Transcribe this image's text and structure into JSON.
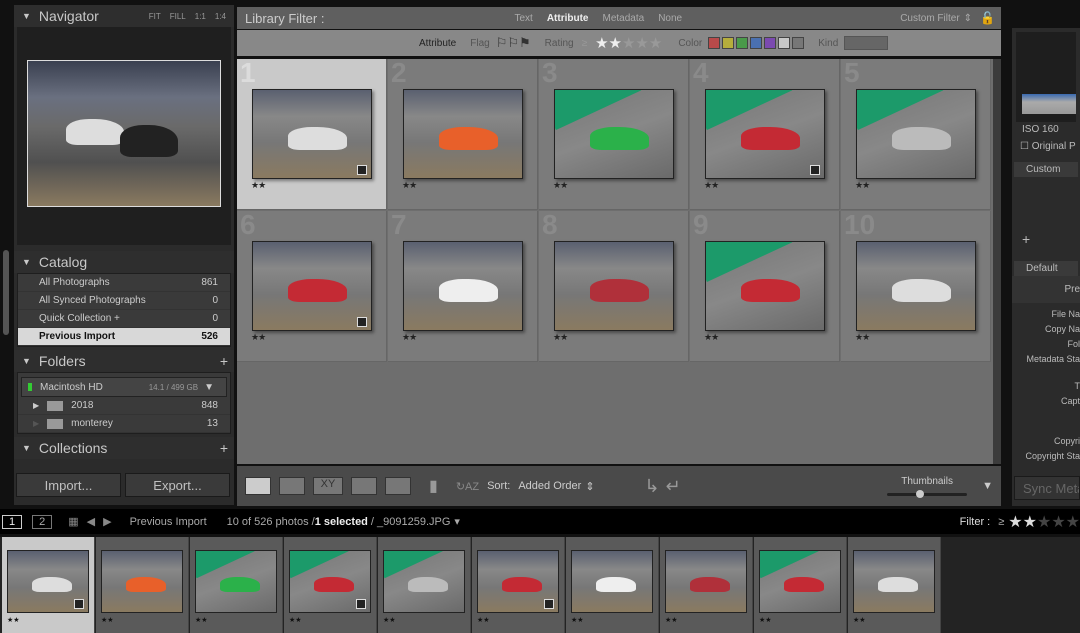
{
  "navigator": {
    "title": "Navigator",
    "options": [
      "FIT",
      "FILL",
      "1:1",
      "1:4"
    ]
  },
  "catalog": {
    "title": "Catalog",
    "items": [
      {
        "label": "All Photographs",
        "count": "861"
      },
      {
        "label": "All Synced Photographs",
        "count": "0"
      },
      {
        "label": "Quick Collection +",
        "count": "0"
      },
      {
        "label": "Previous Import",
        "count": "526",
        "selected": true
      }
    ]
  },
  "folders": {
    "title": "Folders",
    "volume": {
      "name": "Macintosh HD",
      "usage": "14.1 / 499 GB"
    },
    "items": [
      {
        "label": "2018",
        "count": "848"
      },
      {
        "label": "monterey",
        "count": "13"
      }
    ]
  },
  "collections": {
    "title": "Collections"
  },
  "buttons": {
    "import": "Import...",
    "export": "Export..."
  },
  "library_filter": {
    "label": "Library Filter :",
    "tabs": [
      "Text",
      "Attribute",
      "Metadata",
      "None"
    ],
    "active": "Attribute",
    "preset": "Custom Filter"
  },
  "attribute_bar": {
    "label": "Attribute",
    "flag": "Flag",
    "rating": "Rating",
    "rating_op": "≥",
    "rating_value": 2,
    "color": "Color",
    "kind": "Kind",
    "colors": [
      "#b84a4a",
      "#b5ad3c",
      "#4a9a4a",
      "#4a70b0",
      "#7b4ab0",
      "#c8c8c8",
      "#777777"
    ]
  },
  "grid": {
    "cells": [
      {
        "n": "1",
        "stars": "★★",
        "car": "#dddddd",
        "green": false,
        "badge": true,
        "selected": true
      },
      {
        "n": "2",
        "stars": "★★",
        "car": "#e8602a",
        "green": false,
        "badge": false
      },
      {
        "n": "3",
        "stars": "★★",
        "car": "#2bb14a",
        "green": true,
        "badge": false
      },
      {
        "n": "4",
        "stars": "★★",
        "car": "#c42a34",
        "green": true,
        "badge": true
      },
      {
        "n": "5",
        "stars": "★★",
        "car": "#bbbbbb",
        "green": true,
        "badge": false
      },
      {
        "n": "6",
        "stars": "★★",
        "car": "#c42a34",
        "green": false,
        "badge": true
      },
      {
        "n": "7",
        "stars": "★★",
        "car": "#eeeeee",
        "green": false,
        "badge": false
      },
      {
        "n": "8",
        "stars": "★★",
        "car": "#b0303a",
        "green": false,
        "badge": false
      },
      {
        "n": "9",
        "stars": "★★",
        "car": "#c42a34",
        "green": true,
        "badge": false
      },
      {
        "n": "10",
        "stars": "★★",
        "car": "#dddddd",
        "green": false,
        "badge": false
      }
    ]
  },
  "toolbar": {
    "sort_label": "Sort:",
    "sort_value": "Added Order",
    "thumbnails_label": "Thumbnails",
    "thumbnail_size": 0.4
  },
  "right_panel": {
    "iso": "ISO 160",
    "original": "Original P",
    "custom": "Custom",
    "default": "Default",
    "preset": "Pre",
    "fields": [
      "File Na",
      "Copy Na",
      "Fol",
      "Metadata Sta",
      "T",
      "Capt",
      "Copyri",
      "Copyright Sta"
    ],
    "sync": "Sync Meta"
  },
  "filmstrip": {
    "screen1": "1",
    "screen2": "2",
    "source": "Previous Import",
    "count": "10 of 526 photos /",
    "selected": "1 selected",
    "file": "/ _9091259.JPG",
    "filter_label": "Filter :",
    "filter_op": "≥",
    "filter_stars": 2
  }
}
